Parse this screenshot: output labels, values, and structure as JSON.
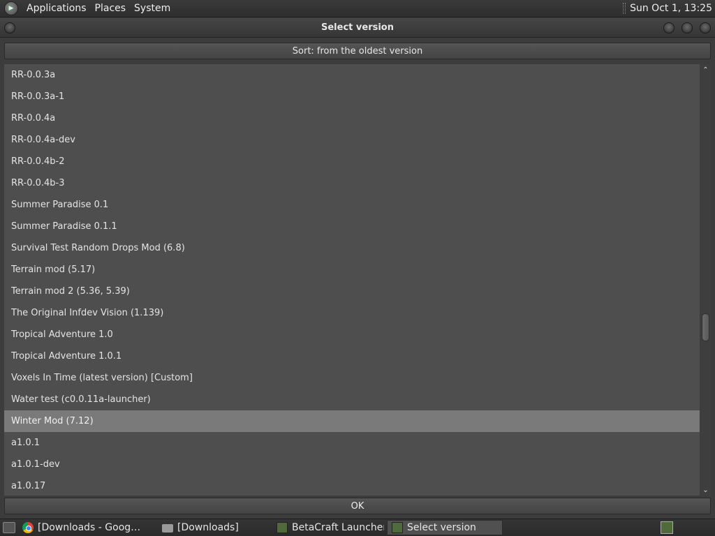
{
  "top_panel": {
    "menu": [
      "Applications",
      "Places",
      "System"
    ],
    "clock": "Sun Oct  1, 13:25"
  },
  "window": {
    "title": "Select version"
  },
  "sort_button": "Sort: from the oldest version",
  "versions": [
    "RR-0.0.3a",
    "RR-0.0.3a-1",
    "RR-0.0.4a",
    "RR-0.0.4a-dev",
    "RR-0.0.4b-2",
    "RR-0.0.4b-3",
    "Summer Paradise 0.1",
    "Summer Paradise 0.1.1",
    "Survival Test Random Drops Mod (6.8)",
    "Terrain mod (5.17)",
    "Terrain mod 2 (5.36, 5.39)",
    "The Original Infdev Vision (1.139)",
    "Tropical Adventure 1.0",
    "Tropical Adventure 1.0.1",
    "Voxels In Time (latest version) [Custom]",
    "Water test (c0.0.11a-launcher)",
    "Winter Mod (7.12)",
    "a1.0.1",
    "a1.0.1-dev",
    "a1.0.17"
  ],
  "selected_version": "Winter Mod (7.12)",
  "ok_button": "OK",
  "taskbar": {
    "tasks": [
      {
        "label": "[Downloads - Goog…",
        "icon": "chrome-icon"
      },
      {
        "label": "[Downloads]",
        "icon": "folder-icon"
      },
      {
        "label": "BetaCraft Launcher …",
        "icon": "betacraft-icon"
      },
      {
        "label": "Select version",
        "icon": "betacraft-icon"
      }
    ]
  },
  "colors": {
    "list_bg": "#4e4e4e",
    "selected_bg": "#7a7a7a",
    "panel_bg": "#2e2e2e"
  }
}
